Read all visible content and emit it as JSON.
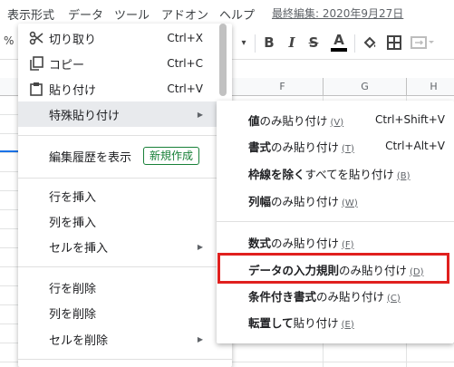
{
  "menubar": {
    "items": [
      "表示形式",
      "データ",
      "ツール",
      "アドオン",
      "ヘルプ"
    ],
    "last_edit": "最終編集: 2020年9月27日"
  },
  "toolbar": {
    "percent": "%",
    "bold": "B",
    "italic": "I",
    "strike": "S",
    "text_color": "A"
  },
  "grid": {
    "columns": [
      "F",
      "G",
      "H"
    ]
  },
  "context_menu": {
    "cut": {
      "label": "切り取り",
      "shortcut": "Ctrl+X"
    },
    "copy": {
      "label": "コピー",
      "shortcut": "Ctrl+C"
    },
    "paste": {
      "label": "貼り付け",
      "shortcut": "Ctrl+V"
    },
    "paste_special": {
      "label": "特殊貼り付け"
    },
    "edit_history": {
      "label": "編集履歴を表示",
      "badge": "新規作成"
    },
    "insert_row": {
      "label": "行を挿入"
    },
    "insert_column": {
      "label": "列を挿入"
    },
    "insert_cells": {
      "label": "セルを挿入"
    },
    "delete_row": {
      "label": "行を削除"
    },
    "delete_column": {
      "label": "列を削除"
    },
    "delete_cells": {
      "label": "セルを削除"
    }
  },
  "submenu": {
    "values_only": {
      "bold": "値",
      "rest": "のみ貼り付け",
      "accel": "(V)",
      "shortcut": "Ctrl+Shift+V"
    },
    "format_only": {
      "bold": "書式",
      "rest": "のみ貼り付け",
      "accel": "(T)",
      "shortcut": "Ctrl+Alt+V"
    },
    "all_except_borders": {
      "bold": "枠線を除く",
      "rest": "すべてを貼り付け",
      "accel": "(B)"
    },
    "column_width_only": {
      "bold": "列幅",
      "rest": "のみ貼り付け",
      "accel": "(W)"
    },
    "formula_only": {
      "bold": "数式",
      "rest": "のみ貼り付け",
      "accel": "(F)"
    },
    "data_validation_only": {
      "bold": "データの入力規則",
      "rest": "のみ貼り付け",
      "accel": "(D)"
    },
    "conditional_format_only": {
      "bold": "条件付き書式",
      "rest": "のみ貼り付け",
      "accel": "(C)"
    },
    "transpose": {
      "bold": "転置して",
      "rest": "貼り付け",
      "accel": "(E)"
    }
  },
  "colors": {
    "highlight_box": "#e0201e",
    "badge_green": "#188038",
    "selection_blue": "#1a73e8"
  }
}
